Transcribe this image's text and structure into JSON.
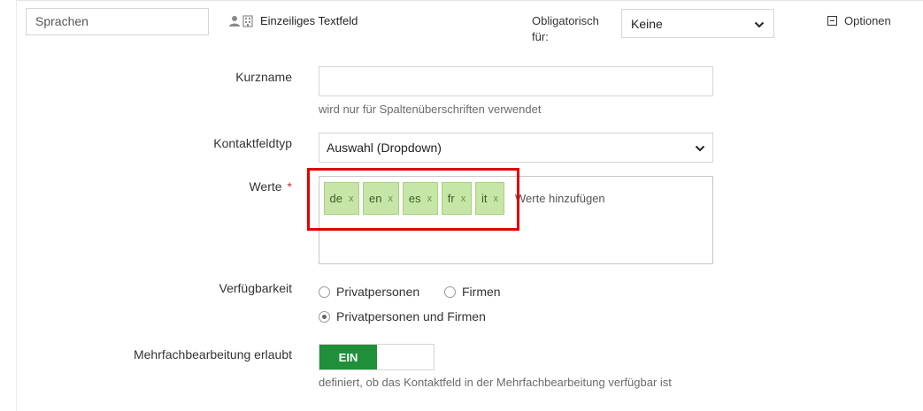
{
  "header": {
    "field_name": "Sprachen",
    "field_type": "Einzeiliges Textfeld",
    "obligatory_label": "Obligatorisch für:",
    "obligatory_value": "Keine",
    "options_label": "Optionen"
  },
  "form": {
    "kurzname": {
      "label": "Kurzname",
      "value": "",
      "hint": "wird nur für Spaltenüberschriften verwendet"
    },
    "kontaktfeldtyp": {
      "label": "Kontaktfeldtyp",
      "value": "Auswahl (Dropdown)"
    },
    "werte": {
      "label": "Werte",
      "required_mark": "*",
      "tags": [
        {
          "label": "de",
          "remove": "x"
        },
        {
          "label": "en",
          "remove": "x"
        },
        {
          "label": "es",
          "remove": "x"
        },
        {
          "label": "fr",
          "remove": "x"
        },
        {
          "label": "it",
          "remove": "x"
        }
      ],
      "placeholder": "Werte hinzufügen"
    },
    "verfuegbarkeit": {
      "label": "Verfügbarkeit",
      "options": [
        {
          "label": "Privatpersonen",
          "selected": false
        },
        {
          "label": "Firmen",
          "selected": false
        },
        {
          "label": "Privatpersonen und Firmen",
          "selected": true
        }
      ]
    },
    "mehrfach": {
      "label": "Mehrfachbearbeitung erlaubt",
      "toggle_label": "EIN",
      "enabled": true,
      "hint": "definiert, ob das Kontaktfeld in der Mehrfachbearbeitung verfügbar ist"
    }
  },
  "colors": {
    "tag_bg": "#c5e6a6",
    "toggle_on": "#1f8f3a",
    "required": "#d0312d",
    "highlight": "#e00000"
  }
}
